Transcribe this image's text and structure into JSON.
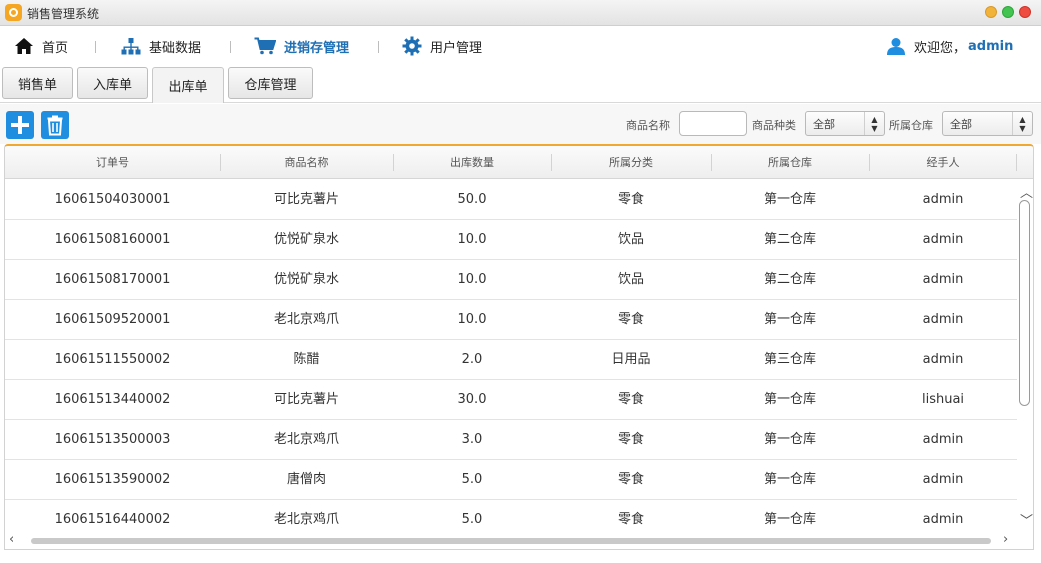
{
  "window": {
    "title": "销售管理系统"
  },
  "nav": {
    "items": [
      {
        "label": "首页"
      },
      {
        "label": "基础数据"
      },
      {
        "label": "进销存管理"
      },
      {
        "label": "用户管理"
      }
    ],
    "welcome_prefix": "欢迎您，",
    "username": "admin"
  },
  "tabs": [
    {
      "label": "销售单"
    },
    {
      "label": "入库单"
    },
    {
      "label": "出库单"
    },
    {
      "label": "仓库管理"
    }
  ],
  "active_tab": "出库单",
  "toolbar": {
    "filters": {
      "product_name_label": "商品名称",
      "product_name_value": "",
      "category_label": "商品种类",
      "category_value": "全部",
      "warehouse_label": "所属仓库",
      "warehouse_value": "全部"
    }
  },
  "table": {
    "columns": [
      "订单号",
      "商品名称",
      "出库数量",
      "所属分类",
      "所属仓库",
      "经手人"
    ],
    "rows": [
      [
        "16061504030001",
        "可比克薯片",
        "50.0",
        "零食",
        "第一仓库",
        "admin"
      ],
      [
        "16061508160001",
        "优悦矿泉水",
        "10.0",
        "饮品",
        "第二仓库",
        "admin"
      ],
      [
        "16061508170001",
        "优悦矿泉水",
        "10.0",
        "饮品",
        "第二仓库",
        "admin"
      ],
      [
        "16061509520001",
        "老北京鸡爪",
        "10.0",
        "零食",
        "第一仓库",
        "admin"
      ],
      [
        "16061511550002",
        "陈醋",
        "2.0",
        "日用品",
        "第三仓库",
        "admin"
      ],
      [
        "16061513440002",
        "可比克薯片",
        "30.0",
        "零食",
        "第一仓库",
        "lishuai"
      ],
      [
        "16061513500003",
        "老北京鸡爪",
        "3.0",
        "零食",
        "第一仓库",
        "admin"
      ],
      [
        "16061513590002",
        "唐僧肉",
        "5.0",
        "零食",
        "第一仓库",
        "admin"
      ],
      [
        "16061516440002",
        "老北京鸡爪",
        "5.0",
        "零食",
        "第一仓库",
        "admin"
      ]
    ]
  },
  "colors": {
    "accent": "#1f6fb5",
    "button_blue": "#1f8de0",
    "table_top_border": "#f0a830"
  }
}
